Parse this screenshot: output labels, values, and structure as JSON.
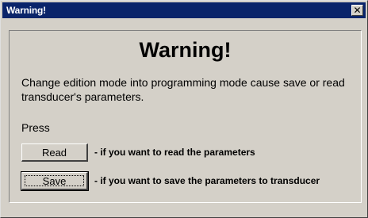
{
  "window": {
    "title": "Warning!",
    "close_glyph": "✕"
  },
  "dialog": {
    "heading": "Warning!",
    "message": "Change edition mode into programming mode cause save or read transducer's parameters.",
    "press_label": "Press",
    "read_button": "Read",
    "read_description": "- if you want to read the parameters",
    "save_button": "Save",
    "save_description": "- if you want to save the parameters to transducer"
  },
  "colors": {
    "titlebar": "#0a246a",
    "face": "#d4d0c8"
  },
  "icons": {
    "close": "close-icon"
  }
}
